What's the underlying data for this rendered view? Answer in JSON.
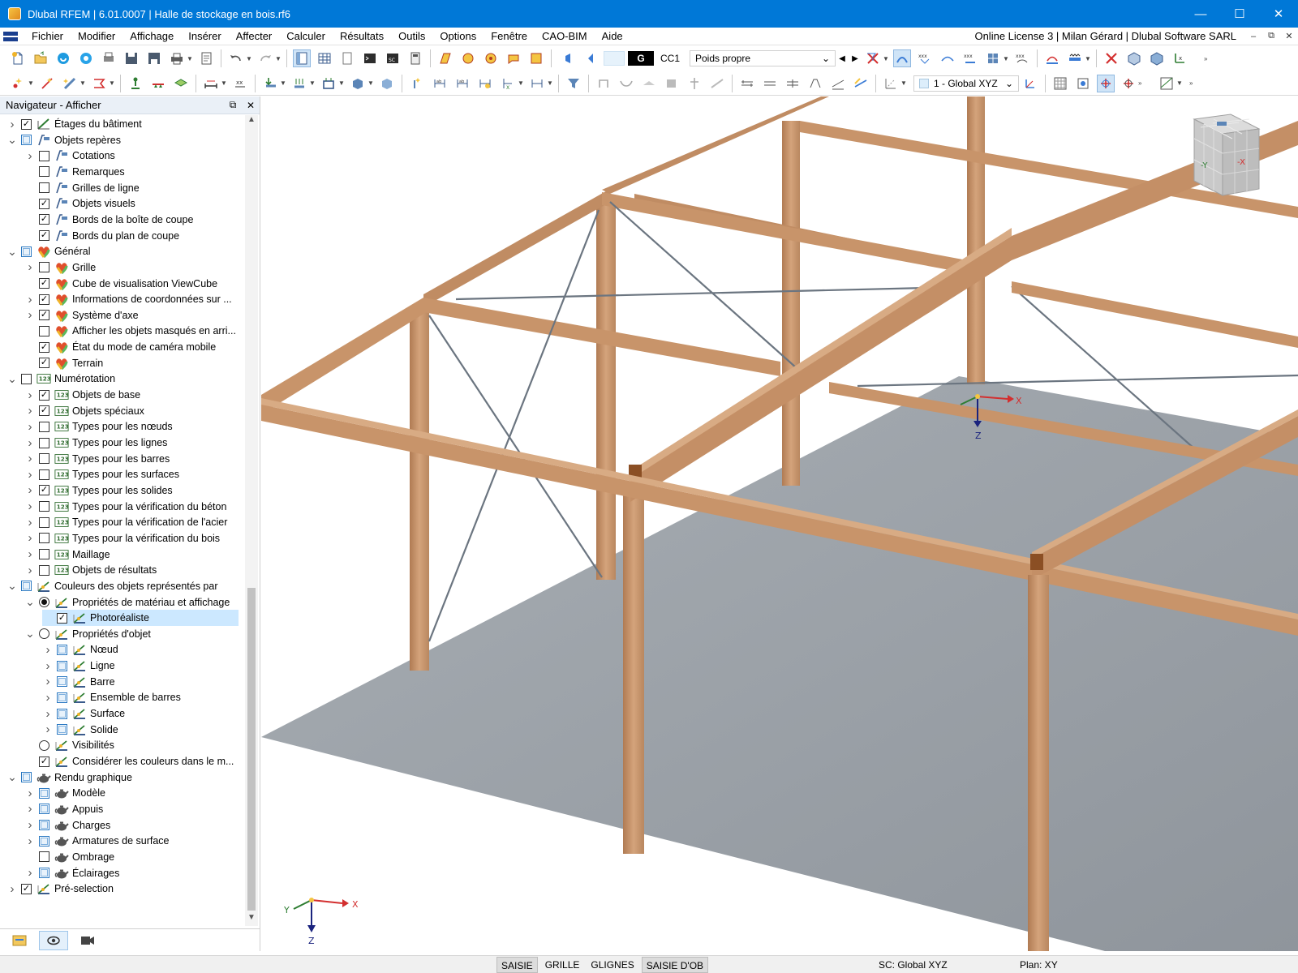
{
  "window": {
    "title": "Dlubal RFEM | 6.01.0007 | Halle de stockage en bois.rf6",
    "minimize": "—",
    "maximize": "☐",
    "close": "✕"
  },
  "menu": {
    "items": [
      "Fichier",
      "Modifier",
      "Affichage",
      "Insérer",
      "Affecter",
      "Calculer",
      "Résultats",
      "Outils",
      "Options",
      "Fenêtre",
      "CAO-BIM",
      "Aide"
    ],
    "license": "Online License 3 | Milan Gérard | Dlubal Software SARL",
    "mdi_min": "–",
    "mdi_restore": "⧉",
    "mdi_close": "✕"
  },
  "toolbar": {
    "load_case_code": "G",
    "load_case_id": "CC1",
    "load_case_name": "Poids propre",
    "coordinate_system": "1 - Global XYZ"
  },
  "navigator": {
    "title": "Navigateur - Afficher",
    "items": [
      {
        "label": "Étages du bâtiment",
        "level": 0,
        "exp": "right",
        "ctrl": "cb",
        "state": "checked",
        "icon": "building"
      },
      {
        "label": "Objets repères",
        "level": 0,
        "exp": "down",
        "ctrl": "cb",
        "state": "partial",
        "icon": "guide"
      },
      {
        "label": "Cotations",
        "level": 1,
        "exp": "right",
        "ctrl": "cb",
        "state": "unchecked",
        "icon": "guide"
      },
      {
        "label": "Remarques",
        "level": 1,
        "exp": "",
        "ctrl": "cb",
        "state": "unchecked",
        "icon": "guide"
      },
      {
        "label": "Grilles de ligne",
        "level": 1,
        "exp": "",
        "ctrl": "cb",
        "state": "unchecked",
        "icon": "guide"
      },
      {
        "label": "Objets visuels",
        "level": 1,
        "exp": "",
        "ctrl": "cb",
        "state": "checked",
        "icon": "guide"
      },
      {
        "label": "Bords de la boîte de coupe",
        "level": 1,
        "exp": "",
        "ctrl": "cb",
        "state": "checked",
        "icon": "guide"
      },
      {
        "label": "Bords du plan de coupe",
        "level": 1,
        "exp": "",
        "ctrl": "cb",
        "state": "checked",
        "icon": "guide"
      },
      {
        "label": "Général",
        "level": 0,
        "exp": "down",
        "ctrl": "cb",
        "state": "partial",
        "icon": "general"
      },
      {
        "label": "Grille",
        "level": 1,
        "exp": "right",
        "ctrl": "cb",
        "state": "unchecked",
        "icon": "general"
      },
      {
        "label": "Cube de visualisation ViewCube",
        "level": 1,
        "exp": "",
        "ctrl": "cb",
        "state": "checked",
        "icon": "general"
      },
      {
        "label": "Informations de coordonnées sur ...",
        "level": 1,
        "exp": "right",
        "ctrl": "cb",
        "state": "checked",
        "icon": "general"
      },
      {
        "label": "Système d'axe",
        "level": 1,
        "exp": "right",
        "ctrl": "cb",
        "state": "checked",
        "icon": "general"
      },
      {
        "label": "Afficher les objets masqués en arri...",
        "level": 1,
        "exp": "",
        "ctrl": "cb",
        "state": "unchecked",
        "icon": "general"
      },
      {
        "label": "État du mode de caméra mobile",
        "level": 1,
        "exp": "",
        "ctrl": "cb",
        "state": "checked",
        "icon": "general"
      },
      {
        "label": "Terrain",
        "level": 1,
        "exp": "",
        "ctrl": "cb",
        "state": "checked",
        "icon": "general"
      },
      {
        "label": "Numérotation",
        "level": 0,
        "exp": "down",
        "ctrl": "cb",
        "state": "unchecked",
        "icon": "num"
      },
      {
        "label": "Objets de base",
        "level": 1,
        "exp": "right",
        "ctrl": "cb",
        "state": "checked",
        "icon": "num"
      },
      {
        "label": "Objets spéciaux",
        "level": 1,
        "exp": "right",
        "ctrl": "cb",
        "state": "checked",
        "icon": "num"
      },
      {
        "label": "Types pour les nœuds",
        "level": 1,
        "exp": "right",
        "ctrl": "cb",
        "state": "unchecked",
        "icon": "num"
      },
      {
        "label": "Types pour les lignes",
        "level": 1,
        "exp": "right",
        "ctrl": "cb",
        "state": "unchecked",
        "icon": "num"
      },
      {
        "label": "Types pour les barres",
        "level": 1,
        "exp": "right",
        "ctrl": "cb",
        "state": "unchecked",
        "icon": "num"
      },
      {
        "label": "Types pour les surfaces",
        "level": 1,
        "exp": "right",
        "ctrl": "cb",
        "state": "unchecked",
        "icon": "num"
      },
      {
        "label": "Types pour les solides",
        "level": 1,
        "exp": "right",
        "ctrl": "cb",
        "state": "checked",
        "icon": "num"
      },
      {
        "label": "Types pour la vérification du béton",
        "level": 1,
        "exp": "right",
        "ctrl": "cb",
        "state": "unchecked",
        "icon": "num"
      },
      {
        "label": "Types pour la vérification de l'acier",
        "level": 1,
        "exp": "right",
        "ctrl": "cb",
        "state": "unchecked",
        "icon": "num"
      },
      {
        "label": "Types pour la vérification du bois",
        "level": 1,
        "exp": "right",
        "ctrl": "cb",
        "state": "unchecked",
        "icon": "num"
      },
      {
        "label": "Maillage",
        "level": 1,
        "exp": "right",
        "ctrl": "cb",
        "state": "unchecked",
        "icon": "num"
      },
      {
        "label": "Objets de résultats",
        "level": 1,
        "exp": "right",
        "ctrl": "cb",
        "state": "unchecked",
        "icon": "num"
      },
      {
        "label": "Couleurs des objets représentés par",
        "level": 0,
        "exp": "down",
        "ctrl": "cb",
        "state": "partial",
        "icon": "color"
      },
      {
        "label": "Propriétés de matériau et affichage",
        "level": 1,
        "exp": "down",
        "ctrl": "rb",
        "state": "on",
        "icon": "color"
      },
      {
        "label": "Photoréaliste",
        "level": 2,
        "exp": "",
        "ctrl": "cb",
        "state": "checked",
        "icon": "color",
        "selected": true
      },
      {
        "label": "Propriétés d'objet",
        "level": 1,
        "exp": "down",
        "ctrl": "rb",
        "state": "off",
        "icon": "color"
      },
      {
        "label": "Nœud",
        "level": 2,
        "exp": "right",
        "ctrl": "cb",
        "state": "partial",
        "icon": "color"
      },
      {
        "label": "Ligne",
        "level": 2,
        "exp": "right",
        "ctrl": "cb",
        "state": "partial",
        "icon": "color"
      },
      {
        "label": "Barre",
        "level": 2,
        "exp": "right",
        "ctrl": "cb",
        "state": "partial",
        "icon": "color"
      },
      {
        "label": "Ensemble de barres",
        "level": 2,
        "exp": "right",
        "ctrl": "cb",
        "state": "partial",
        "icon": "color"
      },
      {
        "label": "Surface",
        "level": 2,
        "exp": "right",
        "ctrl": "cb",
        "state": "partial",
        "icon": "color"
      },
      {
        "label": "Solide",
        "level": 2,
        "exp": "right",
        "ctrl": "cb",
        "state": "partial",
        "icon": "color"
      },
      {
        "label": "Visibilités",
        "level": 1,
        "exp": "",
        "ctrl": "rb",
        "state": "off",
        "icon": "color"
      },
      {
        "label": "Considérer les couleurs dans le m...",
        "level": 1,
        "exp": "",
        "ctrl": "cb",
        "state": "checked",
        "icon": "color"
      },
      {
        "label": "Rendu graphique",
        "level": 0,
        "exp": "down",
        "ctrl": "cb",
        "state": "partial",
        "icon": "teapot"
      },
      {
        "label": "Modèle",
        "level": 1,
        "exp": "right",
        "ctrl": "cb",
        "state": "partial",
        "icon": "teapot"
      },
      {
        "label": "Appuis",
        "level": 1,
        "exp": "right",
        "ctrl": "cb",
        "state": "partial",
        "icon": "teapot"
      },
      {
        "label": "Charges",
        "level": 1,
        "exp": "right",
        "ctrl": "cb",
        "state": "partial",
        "icon": "teapot"
      },
      {
        "label": "Armatures de surface",
        "level": 1,
        "exp": "right",
        "ctrl": "cb",
        "state": "partial",
        "icon": "teapot"
      },
      {
        "label": "Ombrage",
        "level": 1,
        "exp": "",
        "ctrl": "cb",
        "state": "unchecked",
        "icon": "teapot"
      },
      {
        "label": "Éclairages",
        "level": 1,
        "exp": "right",
        "ctrl": "cb",
        "state": "partial",
        "icon": "teapot"
      },
      {
        "label": "Pré-selection",
        "level": 0,
        "exp": "right",
        "ctrl": "cb",
        "state": "checked",
        "icon": "color"
      }
    ]
  },
  "viewport": {
    "axis_labels": {
      "x": "X",
      "y": "Y",
      "z": "Z"
    },
    "viewcube_labels": {
      "minus_y": "-Y",
      "minus_x": "-X"
    }
  },
  "statusbar": {
    "buttons": [
      "SAISIE",
      "GRILLE",
      "GLIGNES",
      "SAISIE D'OB"
    ],
    "coordinate_system": "SC: Global XYZ",
    "plane": "Plan: XY"
  },
  "colors": {
    "titlebar": "#0078d7",
    "timber": "#c8946a",
    "floor": "#9aa1a8",
    "selection": "#cce8ff"
  }
}
